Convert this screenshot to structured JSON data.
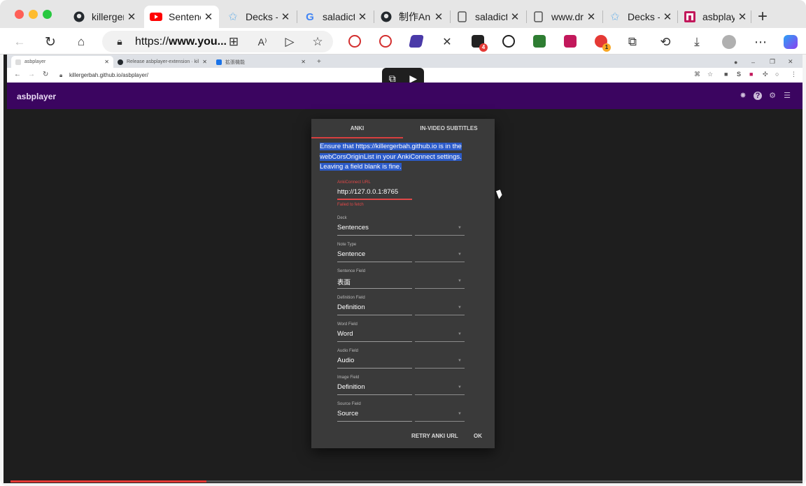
{
  "outer_tabs": [
    {
      "label": "killergerbah",
      "icon": "github-icon"
    },
    {
      "label": "Sentence",
      "icon": "youtube-icon"
    },
    {
      "label": "Decks - ",
      "icon": "anki-icon"
    },
    {
      "label": "saladict",
      "icon": "google-icon"
    },
    {
      "label": "制作Anki",
      "icon": "github-icon"
    },
    {
      "label": "saladict",
      "icon": "page-icon"
    },
    {
      "label": "www.dr",
      "icon": "page-icon"
    },
    {
      "label": "Decks - ",
      "icon": "anki-icon"
    },
    {
      "label": "asbplay",
      "icon": "asbplayer-icon"
    }
  ],
  "address_bar": {
    "url_prefix": "https://",
    "url_host": "www.you..."
  },
  "inner_browser": {
    "tabs": [
      {
        "label": "asbplayer"
      },
      {
        "label": "Release asbplayer-extension · kil"
      },
      {
        "label": "拡張機能"
      }
    ],
    "url": "killergerbah.github.io/asbplayer/"
  },
  "app": {
    "title": "asbplayer"
  },
  "dialog": {
    "tabs": [
      "ANKI",
      "IN-VIDEO SUBTITLES"
    ],
    "hint": "Ensure that https://killergerbah.github.io is in the webCorsOriginList in your AnkiConnect settings. Leaving a field blank is fine.",
    "hint_lines": [
      "Ensure that https://killergerbah.github.io is in the",
      "webCorsOriginList in your AnkiConnect settings.",
      "Leaving a field blank is fine."
    ],
    "anki_connect": {
      "label": "AnkiConnect URL",
      "value": "http://127.0.0.1:8765",
      "error": "Failed to fetch"
    },
    "fields": [
      {
        "label": "Deck",
        "value": "Sentences"
      },
      {
        "label": "Note Type",
        "value": "Sentence"
      },
      {
        "label": "Sentence Field",
        "value": "表面"
      },
      {
        "label": "Definition Field",
        "value": "Definition"
      },
      {
        "label": "Word Field",
        "value": "Word"
      },
      {
        "label": "Audio Field",
        "value": "Audio"
      },
      {
        "label": "Image Field",
        "value": "Definition"
      },
      {
        "label": "Source Field",
        "value": "Source"
      }
    ],
    "buttons": {
      "retry": "RETRY ANKI URL",
      "ok": "OK"
    }
  },
  "colors": {
    "app_bar": "#3b0560",
    "accent_red": "#d73f3f",
    "selection_blue": "#2c5bc9"
  }
}
